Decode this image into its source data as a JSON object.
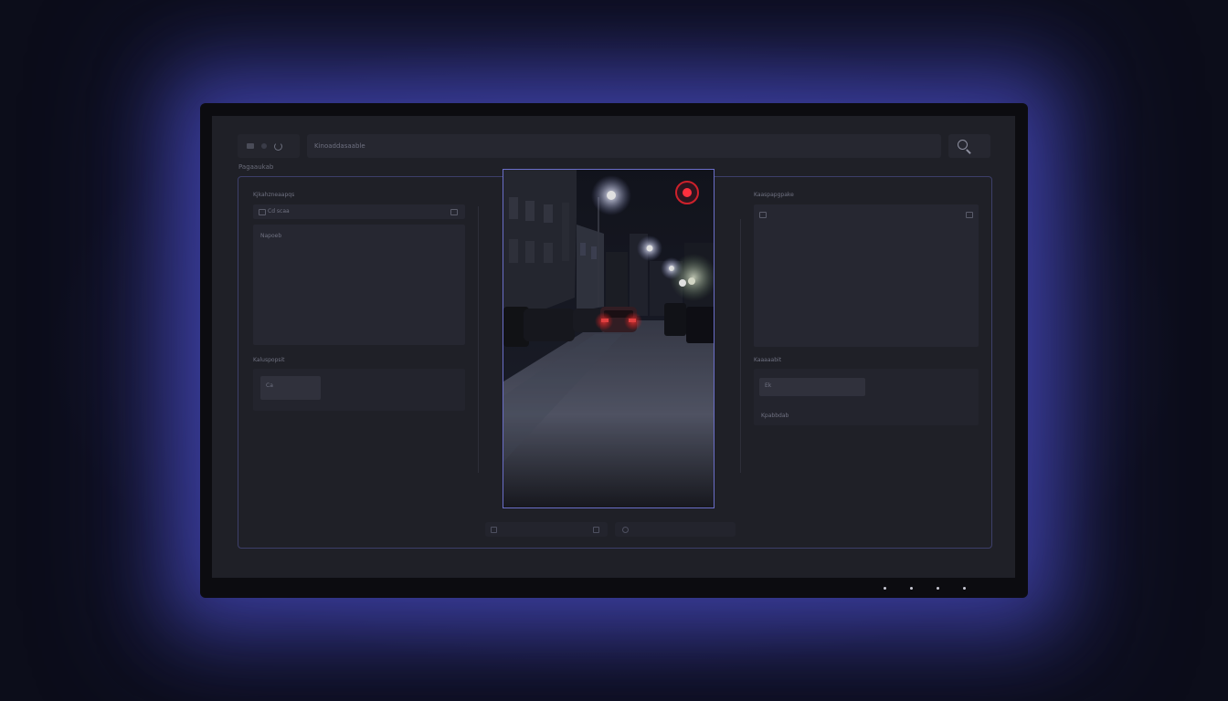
{
  "toolbar": {
    "address_text": "Kinoaddasaable",
    "search_icon": "search-icon"
  },
  "breadcrumb": "Pagaaukab",
  "left_column": {
    "section1_label": "Kjkahzneaapqs",
    "input_bar_text": "Cd scaa",
    "text_panel_label": "Napoeb",
    "section2_label": "Kaluspopsit",
    "chip_text": "Ca"
  },
  "right_column": {
    "section1_label": "Kaaspapgpake",
    "section2_label": "Kaaaaabit",
    "chip_text": "Ek",
    "footer_text": "Kpabbdab"
  },
  "feed": {
    "recording": true,
    "rec_color": "#e8242e",
    "frame_color": "#6a6ec8"
  },
  "colors": {
    "glow": "#5256dc",
    "screen_bg": "#1f2027",
    "panel_bg": "#262731"
  }
}
